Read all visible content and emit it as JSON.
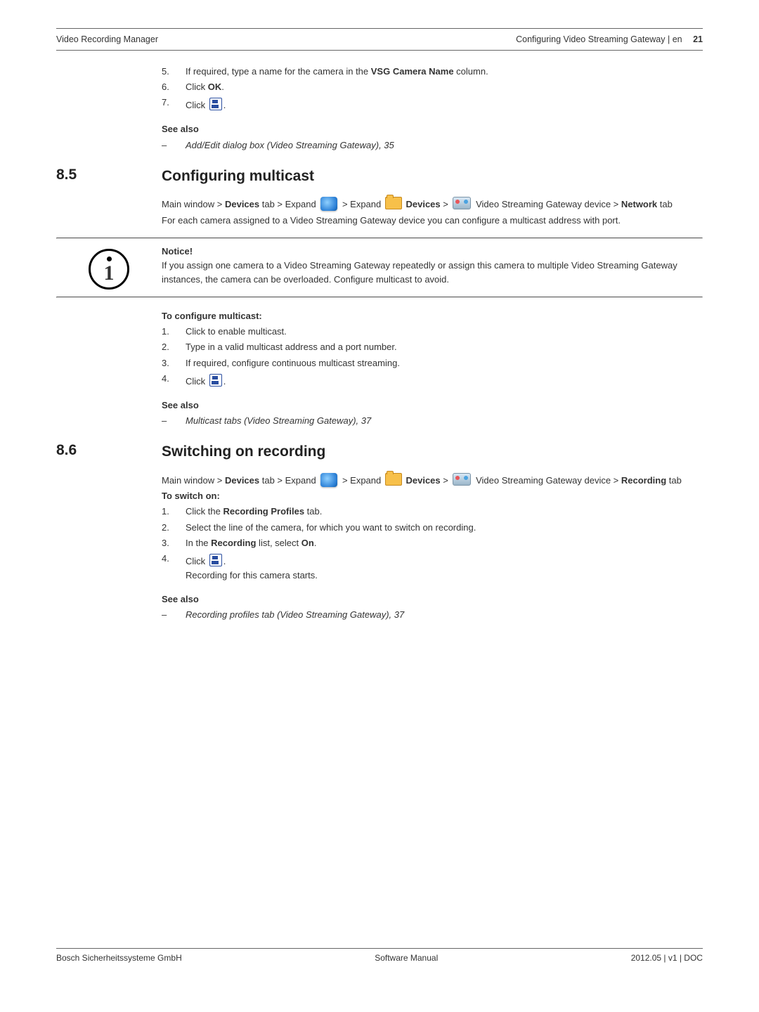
{
  "header": {
    "left": "Video Recording Manager",
    "right": "Configuring Video Streaming Gateway | en",
    "page_number": "21"
  },
  "intro_steps": [
    {
      "n": "5.",
      "pre": "If required, type a name for the camera in the ",
      "bold": "VSG Camera Name",
      "post": " column."
    },
    {
      "n": "6.",
      "pre": "Click ",
      "bold": "OK",
      "post": "."
    },
    {
      "n": "7.",
      "pre": "Click ",
      "icon": true,
      "post": "."
    }
  ],
  "intro_see_also": {
    "heading": "See also",
    "item": "Add/Edit dialog box (Video Streaming Gateway), 35"
  },
  "sec85": {
    "num": "8.5",
    "title": "Configuring multicast",
    "path": {
      "p1": "Main window > ",
      "devices": "Devices",
      "p2": " tab > Expand ",
      "p3": " > Expand ",
      "devices2": "Devices",
      "p4": " > ",
      "p5": " Video Streaming Gateway device > ",
      "network": "Network",
      "p6": " tab"
    },
    "desc": "For each camera assigned to a Video Streaming Gateway device you can configure a multicast address with port.",
    "notice_title": "Notice!",
    "notice_body": "If you assign one camera to a Video Streaming Gateway repeatedly or assign this camera to multiple Video Streaming Gateway instances, the camera can be overloaded. Configure multicast to avoid.",
    "howto_heading": "To configure multicast:",
    "steps": [
      {
        "n": "1.",
        "t": "Click to enable multicast."
      },
      {
        "n": "2.",
        "t": "Type in a valid multicast address and a port number."
      },
      {
        "n": "3.",
        "t": "If required, configure continuous multicast streaming."
      },
      {
        "n": "4.",
        "pre": "Click ",
        "icon": true,
        "post": "."
      }
    ],
    "see_also": {
      "heading": "See also",
      "item": "Multicast tabs (Video Streaming Gateway), 37"
    }
  },
  "sec86": {
    "num": "8.6",
    "title": "Switching on recording",
    "path": {
      "p1": "Main window > ",
      "devices": "Devices",
      "p2": " tab > Expand ",
      "p3": " > Expand ",
      "devices2": "Devices",
      "p4": " > ",
      "p5": " Video Streaming Gateway device > ",
      "recording": "Recording",
      "p6": " tab"
    },
    "howto_heading": "To switch on:",
    "steps": [
      {
        "n": "1.",
        "pre": "Click the ",
        "bold": "Recording Profiles",
        "post": " tab."
      },
      {
        "n": "2.",
        "t": "Select the line of the camera, for which you want to switch on recording."
      },
      {
        "n": "3.",
        "pre": "In the ",
        "bold": "Recording",
        "mid": " list, select ",
        "bold2": "On",
        "post": "."
      },
      {
        "n": "4.",
        "pre": "Click ",
        "icon": true,
        "post": ".",
        "after": "Recording for this camera starts."
      }
    ],
    "see_also": {
      "heading": "See also",
      "item": "Recording profiles tab (Video Streaming Gateway), 37"
    }
  },
  "footer": {
    "left": "Bosch Sicherheitssysteme GmbH",
    "center": "Software Manual",
    "right": "2012.05 | v1 | DOC"
  }
}
